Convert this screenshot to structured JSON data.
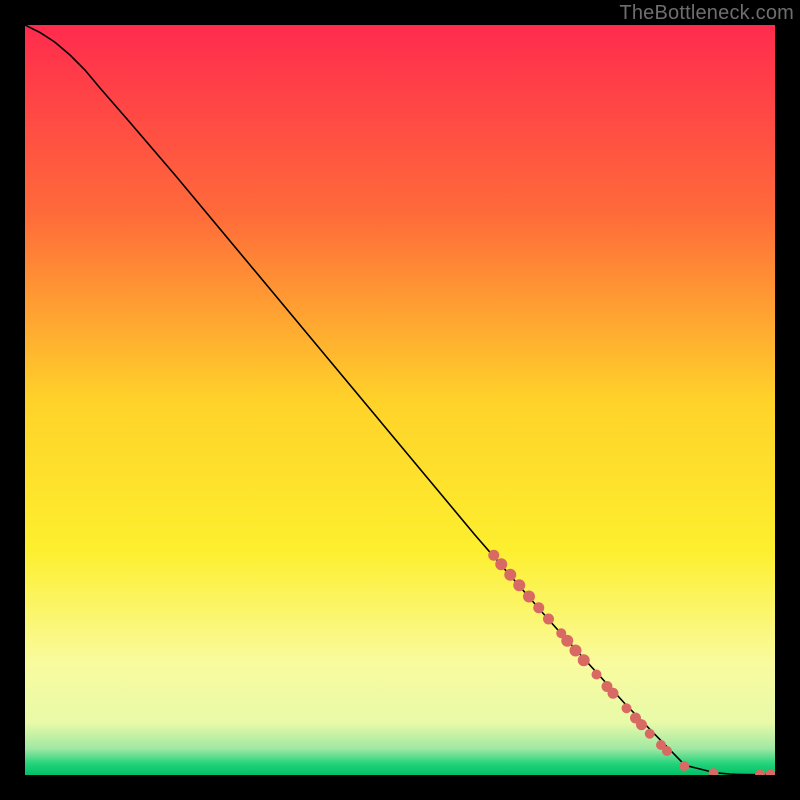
{
  "attribution": "TheBottleneck.com",
  "chart_data": {
    "type": "line",
    "title": "",
    "xlabel": "",
    "ylabel": "",
    "xlim": [
      0,
      100
    ],
    "ylim": [
      0,
      100
    ],
    "grid": false,
    "legend": false,
    "background_gradient": {
      "stops": [
        {
          "offset": 0.0,
          "color": "#ff2b4e"
        },
        {
          "offset": 0.25,
          "color": "#ff6a3a"
        },
        {
          "offset": 0.5,
          "color": "#ffd22a"
        },
        {
          "offset": 0.7,
          "color": "#fdef2e"
        },
        {
          "offset": 0.85,
          "color": "#f9fb9e"
        },
        {
          "offset": 0.93,
          "color": "#e8faa8"
        },
        {
          "offset": 0.965,
          "color": "#9fe8a3"
        },
        {
          "offset": 0.985,
          "color": "#22d37a"
        },
        {
          "offset": 1.0,
          "color": "#00c168"
        }
      ]
    },
    "series": [
      {
        "name": "curve",
        "color": "#000000",
        "x": [
          0,
          2,
          4,
          6,
          8,
          10,
          14,
          20,
          30,
          40,
          50,
          60,
          70,
          80,
          88,
          92,
          94,
          95,
          96,
          98,
          100
        ],
        "y": [
          100,
          99,
          97.7,
          96,
          94,
          91.6,
          87,
          80,
          68,
          56,
          44,
          32,
          20.5,
          9.5,
          1.3,
          0.3,
          0.12,
          0.08,
          0.06,
          0.05,
          0.05
        ]
      }
    ],
    "scatter": {
      "name": "markers",
      "color": "#d86a63",
      "points": [
        {
          "x": 62.5,
          "y": 29.3,
          "r": 5.5
        },
        {
          "x": 63.5,
          "y": 28.1,
          "r": 6.0
        },
        {
          "x": 64.7,
          "y": 26.7,
          "r": 6.0
        },
        {
          "x": 65.9,
          "y": 25.3,
          "r": 6.0
        },
        {
          "x": 67.2,
          "y": 23.8,
          "r": 6.0
        },
        {
          "x": 68.5,
          "y": 22.3,
          "r": 5.5
        },
        {
          "x": 69.8,
          "y": 20.8,
          "r": 5.5
        },
        {
          "x": 71.5,
          "y": 18.9,
          "r": 5.0
        },
        {
          "x": 72.3,
          "y": 17.9,
          "r": 6.0
        },
        {
          "x": 73.4,
          "y": 16.6,
          "r": 6.0
        },
        {
          "x": 74.5,
          "y": 15.3,
          "r": 6.0
        },
        {
          "x": 76.2,
          "y": 13.4,
          "r": 5.0
        },
        {
          "x": 77.6,
          "y": 11.8,
          "r": 5.5
        },
        {
          "x": 78.4,
          "y": 10.9,
          "r": 5.5
        },
        {
          "x": 80.2,
          "y": 8.9,
          "r": 5.0
        },
        {
          "x": 81.4,
          "y": 7.6,
          "r": 5.5
        },
        {
          "x": 82.2,
          "y": 6.7,
          "r": 5.5
        },
        {
          "x": 83.3,
          "y": 5.5,
          "r": 5.0
        },
        {
          "x": 84.8,
          "y": 4.0,
          "r": 5.0
        },
        {
          "x": 85.6,
          "y": 3.2,
          "r": 5.0
        },
        {
          "x": 87.9,
          "y": 1.2,
          "r": 5.0
        },
        {
          "x": 91.8,
          "y": 0.25,
          "r": 5.0
        },
        {
          "x": 98.0,
          "y": 0.05,
          "r": 5.0
        },
        {
          "x": 99.4,
          "y": 0.05,
          "r": 5.0
        }
      ]
    }
  }
}
